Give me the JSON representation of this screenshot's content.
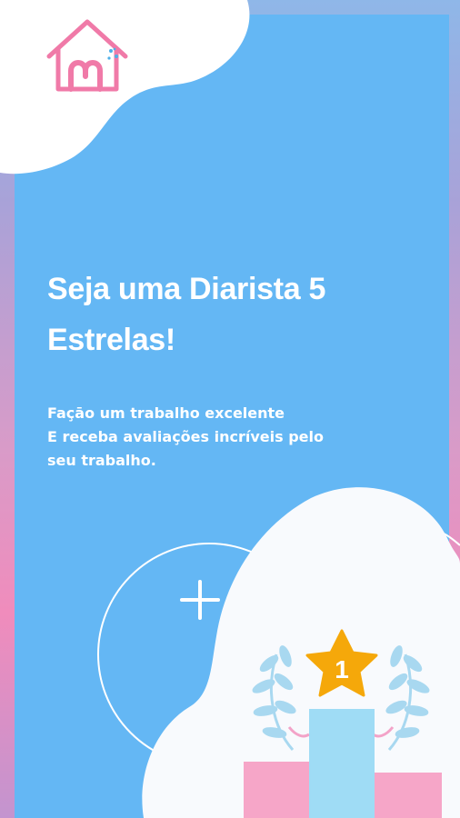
{
  "screen": {
    "headline": "Seja uma Diarista 5 Estrelas!",
    "description": [
      "Façāo um trabalho excelente",
      "E receba avaliações incríveis pelo",
      "seu trabalho."
    ]
  },
  "illustration": {
    "medal_number": "1",
    "icons": [
      "house-logo-icon",
      "star-icon",
      "laurel-left-icon",
      "laurel-right-icon",
      "podium-icon"
    ]
  },
  "colors": {
    "panel": "#64b7f4",
    "logo": "#f07aa8",
    "star": "#f5a80a",
    "podium_center": "#9fdcf5",
    "podium_side": "#f6a6c8",
    "laurel": "#a8d8f0"
  }
}
